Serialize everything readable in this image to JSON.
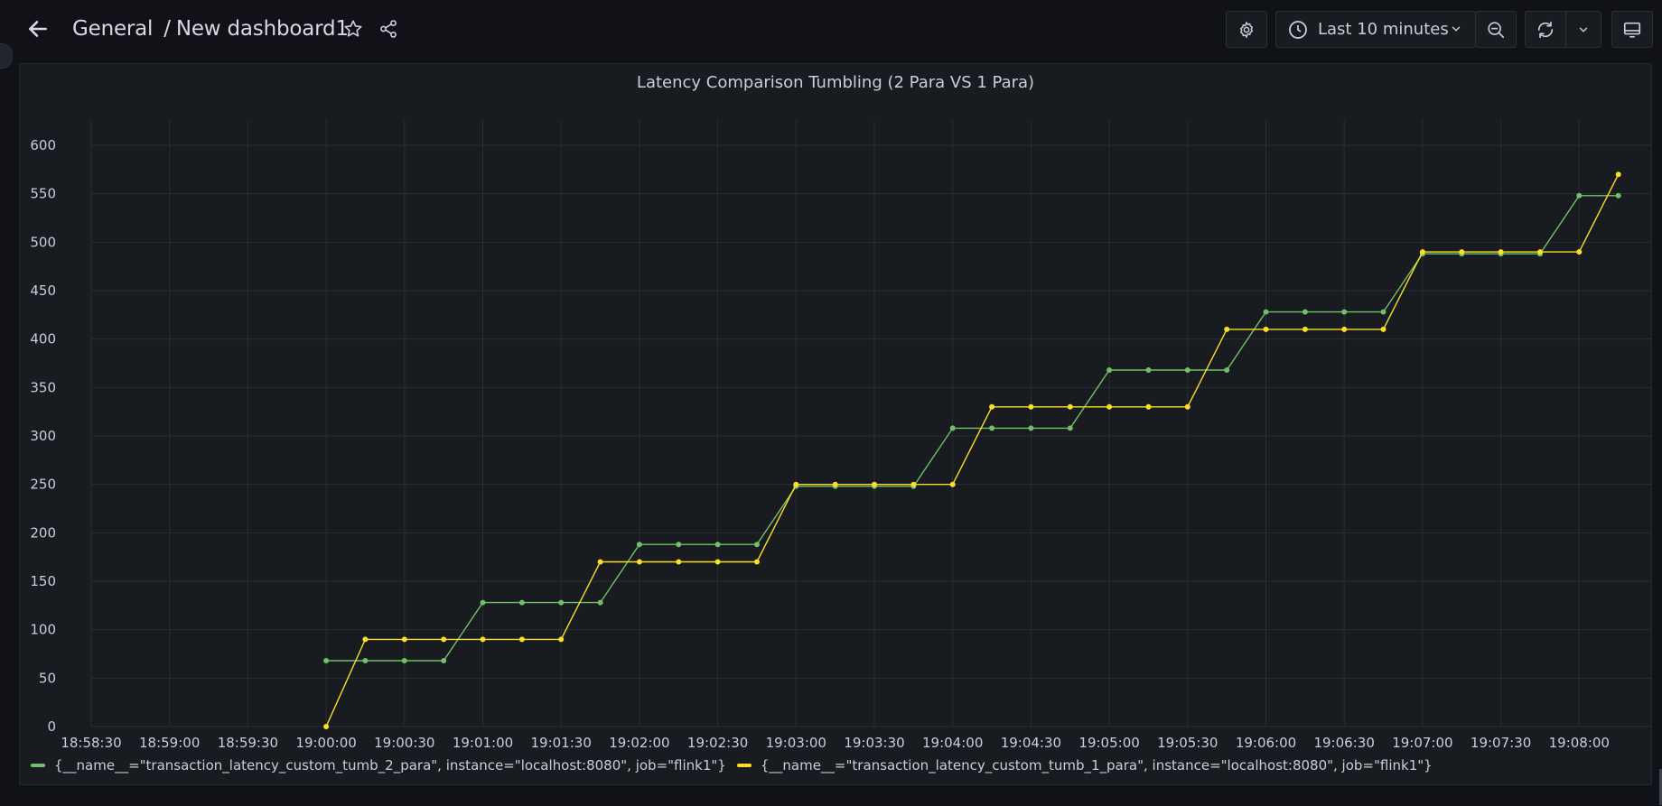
{
  "header": {
    "folder": "General",
    "separator": "/",
    "dashboard_title": "New dashboard1",
    "time_range_label": "Last 10 minutes"
  },
  "icons": {
    "back": "arrow-left-icon",
    "star": "star-icon",
    "share": "share-icon",
    "settings": "gear-icon",
    "clock": "clock-icon",
    "zoom_out": "zoom-out-icon",
    "refresh": "refresh-icon",
    "kiosk": "monitor-icon"
  },
  "panel": {
    "title": "Latency Comparison Tumbling (2 Para VS 1 Para)"
  },
  "colors": {
    "series_green": "#73bf69",
    "series_yellow": "#fade2a",
    "grid": "#2a2d35",
    "axis_text": "#ccccdc"
  },
  "chart_data": {
    "type": "line",
    "title": "Latency Comparison Tumbling (2 Para VS 1 Para)",
    "ylim": [
      0,
      630
    ],
    "y_ticks": [
      "0",
      "50",
      "100",
      "150",
      "200",
      "250",
      "300",
      "350",
      "400",
      "450",
      "500",
      "550",
      "600"
    ],
    "x_ticks": [
      "18:58:30",
      "18:59:00",
      "18:59:30",
      "19:00:00",
      "19:00:30",
      "19:01:00",
      "19:01:30",
      "19:02:00",
      "19:02:30",
      "19:03:00",
      "19:03:30",
      "19:04:00",
      "19:04:30",
      "19:05:00",
      "19:05:30",
      "19:06:00",
      "19:06:30",
      "19:07:00",
      "19:07:30",
      "19:08:00"
    ],
    "x": [
      "19:00:00",
      "19:00:15",
      "19:00:30",
      "19:00:45",
      "19:01:00",
      "19:01:15",
      "19:01:30",
      "19:01:45",
      "19:02:00",
      "19:02:15",
      "19:02:30",
      "19:02:45",
      "19:03:00",
      "19:03:15",
      "19:03:30",
      "19:03:45",
      "19:04:00",
      "19:04:15",
      "19:04:30",
      "19:04:45",
      "19:05:00",
      "19:05:15",
      "19:05:30",
      "19:05:45",
      "19:06:00",
      "19:06:15",
      "19:06:30",
      "19:06:45",
      "19:07:00",
      "19:07:15",
      "19:07:30",
      "19:07:45",
      "19:08:00",
      "19:08:15"
    ],
    "series": [
      {
        "name": "{__name__=\"transaction_latency_custom_tumb_2_para\", instance=\"localhost:8080\", job=\"flink1\"}",
        "color": "#73bf69",
        "values": [
          68,
          68,
          68,
          68,
          128,
          128,
          128,
          128,
          188,
          188,
          188,
          188,
          248,
          248,
          248,
          248,
          308,
          308,
          308,
          308,
          368,
          368,
          368,
          368,
          428,
          428,
          428,
          428,
          488,
          488,
          488,
          488,
          548,
          548
        ]
      },
      {
        "name": "{__name__=\"transaction_latency_custom_tumb_1_para\", instance=\"localhost:8080\", job=\"flink1\"}",
        "color": "#fade2a",
        "values": [
          0,
          90,
          90,
          90,
          90,
          90,
          90,
          170,
          170,
          170,
          170,
          170,
          250,
          250,
          250,
          250,
          250,
          330,
          330,
          330,
          330,
          330,
          330,
          410,
          410,
          410,
          410,
          410,
          490,
          490,
          490,
          490,
          490,
          570
        ]
      }
    ],
    "grid": true,
    "legend_position": "bottom-left"
  }
}
